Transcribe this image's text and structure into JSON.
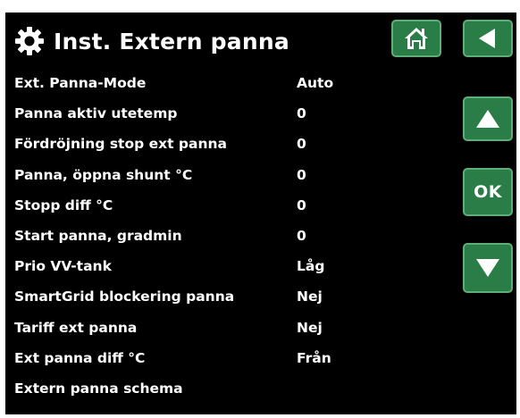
{
  "header": {
    "title": "Inst. Extern panna",
    "icon": "gear-icon"
  },
  "nav": {
    "home_icon": "home-icon",
    "back_icon": "back-arrow-icon",
    "up_icon": "arrow-up-icon",
    "ok_label": "OK",
    "down_icon": "arrow-down-icon"
  },
  "settings": [
    {
      "label": "Ext. Panna-Mode",
      "value": "Auto"
    },
    {
      "label": "Panna aktiv utetemp",
      "value": "0"
    },
    {
      "label": "Fördröjning stop ext panna",
      "value": "0"
    },
    {
      "label": "Panna, öppna shunt °C",
      "value": "0"
    },
    {
      "label": "Stopp diff °C",
      "value": "0"
    },
    {
      "label": "Start panna, gradmin",
      "value": "0"
    },
    {
      "label": "Prio VV-tank",
      "value": "Låg"
    },
    {
      "label": "SmartGrid blockering panna",
      "value": "Nej"
    },
    {
      "label": "Tariff ext panna",
      "value": "Nej"
    },
    {
      "label": "Ext panna diff °C",
      "value": "Från"
    },
    {
      "label": "Extern panna schema",
      "value": ""
    }
  ],
  "colors": {
    "background": "#000000",
    "text": "#ffffff",
    "button_fill": "#2a7d47",
    "button_border": "#5fae7a"
  }
}
